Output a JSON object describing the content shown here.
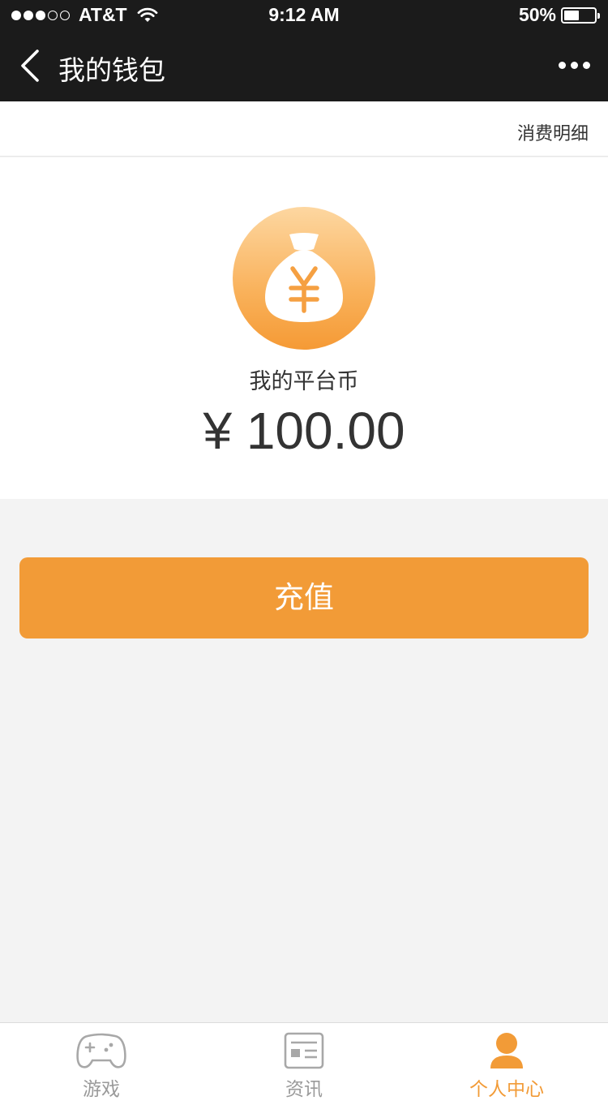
{
  "status_bar": {
    "signal_dots_filled": 3,
    "signal_dots_total": 5,
    "carrier": "AT&T",
    "time": "9:12 AM",
    "battery_percent": "50%",
    "battery_level": 0.5
  },
  "nav": {
    "title": "我的钱包",
    "back_icon": "chevron-left-icon",
    "more_icon": "more-dots-icon"
  },
  "sub_header": {
    "detail_link": "消费明细"
  },
  "wallet": {
    "icon": "money-bag-yuan-icon",
    "coin_symbol": "¥",
    "label": "我的平台币",
    "amount": "¥ 100.00"
  },
  "recharge_button": {
    "label": "充值"
  },
  "tab_bar": {
    "tabs": [
      {
        "label": "游戏",
        "icon": "gamepad-icon",
        "active": false
      },
      {
        "label": "资讯",
        "icon": "news-icon",
        "active": false
      },
      {
        "label": "个人中心",
        "icon": "user-icon",
        "active": true
      }
    ]
  },
  "colors": {
    "nav_bg": "#1b1b1b",
    "accent": "#f29b37",
    "page_bg": "#f3f3f3",
    "inactive_tab": "#9a9a9a"
  }
}
